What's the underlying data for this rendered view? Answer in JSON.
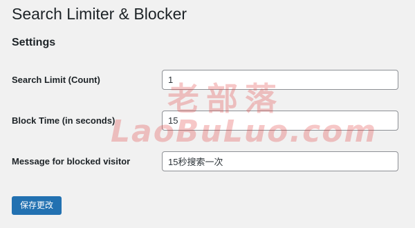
{
  "page": {
    "title": "Search Limiter & Blocker",
    "section_title": "Settings"
  },
  "fields": [
    {
      "label": "Search Limit (Count)",
      "value": "1"
    },
    {
      "label": "Block Time (in seconds)",
      "value": "15"
    },
    {
      "label": "Message for blocked visitor",
      "value": "15秒搜索一次"
    }
  ],
  "actions": {
    "save_label": "保存更改"
  },
  "watermark": {
    "cn": "老部落",
    "en": "LaoBuLuo.com"
  },
  "colors": {
    "background": "#f1f1f1",
    "primary_button": "#2271b1",
    "watermark": "#e23b3b"
  }
}
